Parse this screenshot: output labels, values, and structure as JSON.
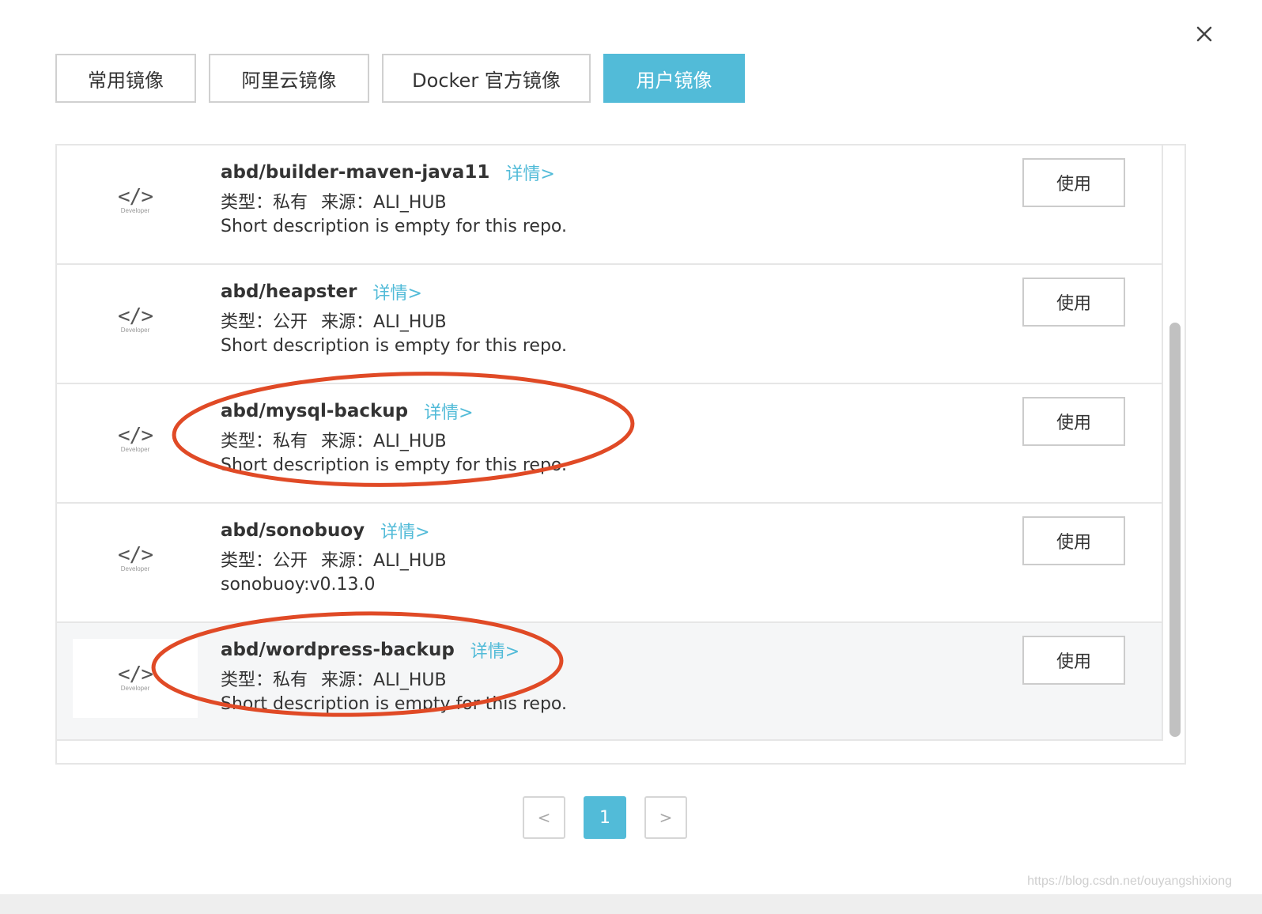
{
  "dialog": {
    "close_icon": "close-icon"
  },
  "tabs": [
    {
      "label": "常用镜像",
      "active": false
    },
    {
      "label": "阿里云镜像",
      "active": false
    },
    {
      "label": "Docker 官方镜像",
      "active": false
    },
    {
      "label": "用户镜像",
      "active": true
    }
  ],
  "list": {
    "icon_glyph": "</>",
    "icon_caption": "Developer",
    "detail_label": "详情>",
    "use_label": "使用",
    "type_prefix": "类型：",
    "source_prefix": "来源：",
    "items": [
      {
        "name": "abd/builder-maven-java11",
        "type": "私有",
        "source": "ALI_HUB",
        "description": "Short description is empty for this repo.",
        "highlighted": false
      },
      {
        "name": "abd/heapster",
        "type": "公开",
        "source": "ALI_HUB",
        "description": "Short description is empty for this repo.",
        "highlighted": false
      },
      {
        "name": "abd/mysql-backup",
        "type": "私有",
        "source": "ALI_HUB",
        "description": "Short description is empty for this repo.",
        "highlighted": false
      },
      {
        "name": "abd/sonobuoy",
        "type": "公开",
        "source": "ALI_HUB",
        "description": "sonobuoy:v0.13.0",
        "highlighted": false
      },
      {
        "name": "abd/wordpress-backup",
        "type": "私有",
        "source": "ALI_HUB",
        "description": "Short description is empty for this repo.",
        "highlighted": true
      }
    ]
  },
  "annotation_color": "#e04a26",
  "accent_color": "#52bbd8",
  "pagination": {
    "prev": "<",
    "current": "1",
    "next": ">"
  },
  "watermark": "https://blog.csdn.net/ouyangshixiong"
}
